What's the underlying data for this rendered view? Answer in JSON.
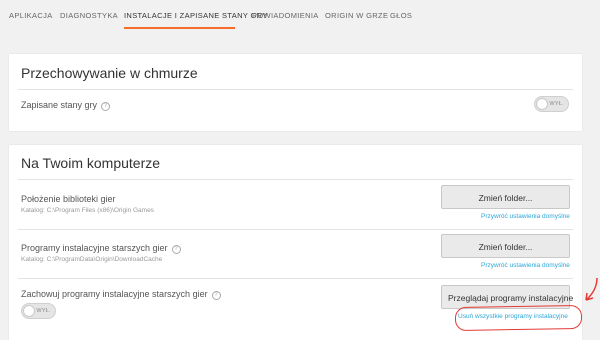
{
  "tabs": [
    {
      "label": "APLIKACJA"
    },
    {
      "label": "DIAGNOSTYKA"
    },
    {
      "label": "INSTALACJE I ZAPISANE STANY GRY"
    },
    {
      "label": "POWIADOMIENIA"
    },
    {
      "label": "ORIGIN W GRZE"
    },
    {
      "label": "GŁOS"
    }
  ],
  "cloud": {
    "title": "Przechowywanie w chmurze",
    "saves_label": "Zapisane stany gry",
    "saves_toggle": "WYŁ."
  },
  "computer": {
    "title": "Na Twoim komputerze",
    "library": {
      "label": "Położenie biblioteki gier",
      "path": "Katalog: C:\\Program Files (x86)\\Origin Games",
      "button": "Zmień folder...",
      "reset": "Przywróć ustawienia domyślne"
    },
    "installers": {
      "label": "Programy instalacyjne starszych gier",
      "path": "Katalog: C:\\ProgramData\\Origin\\DownloadCache",
      "button": "Zmień folder...",
      "reset": "Przywróć ustawienia domyślne"
    },
    "keep": {
      "label": "Zachowuj programy instalacyjne starszych gier",
      "toggle": "WYŁ.",
      "button": "Przeglądaj programy instalacyjne",
      "delete_link": "Usuń wszystkie programy instalacyjne"
    }
  },
  "help_glyph": "?",
  "colors": {
    "accent": "#f56c2d",
    "link": "#2aa6d6",
    "annotation": "#e53935"
  }
}
